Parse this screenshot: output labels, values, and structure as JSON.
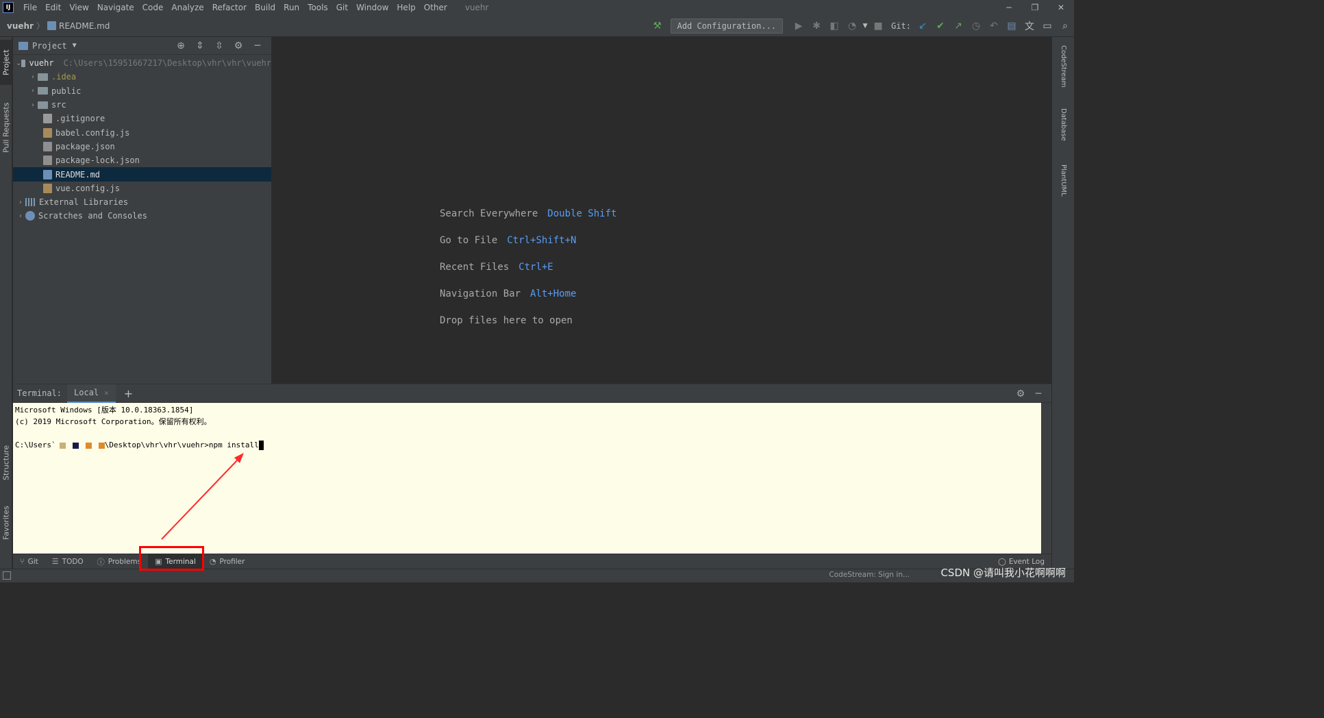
{
  "menubar": {
    "items": [
      "File",
      "Edit",
      "View",
      "Navigate",
      "Code",
      "Analyze",
      "Refactor",
      "Build",
      "Run",
      "Tools",
      "Git",
      "Window",
      "Help",
      "Other"
    ],
    "window_title": "vuehr"
  },
  "navbar": {
    "project": "vuehr",
    "file": "README.md",
    "add_config_label": "Add Configuration...",
    "git_label": "Git:"
  },
  "left_stripe": {
    "project_tab": "Project",
    "pull_requests_tab": "Pull Requests",
    "structure_tab": "Structure",
    "favorites_tab": "Favorites"
  },
  "right_stripe": {
    "codestream_tab": "CodeStream",
    "database_tab": "Database",
    "plantuml_tab": "PlantUML"
  },
  "project_panel": {
    "title": "Project",
    "root": {
      "name": "vuehr",
      "path": "C:\\Users\\15951667217\\Desktop\\vhr\\vhr\\vuehr"
    },
    "folders": [
      ".idea",
      "public",
      "src"
    ],
    "files": [
      ".gitignore",
      "babel.config.js",
      "package.json",
      "package-lock.json",
      "README.md",
      "vue.config.js"
    ],
    "external_libraries": "External Libraries",
    "scratches": "Scratches and Consoles"
  },
  "editor": {
    "hints": [
      {
        "label": "Search Everywhere",
        "key": "Double Shift"
      },
      {
        "label": "Go to File",
        "key": "Ctrl+Shift+N"
      },
      {
        "label": "Recent Files",
        "key": "Ctrl+E"
      },
      {
        "label": "Navigation Bar",
        "key": "Alt+Home"
      },
      {
        "label": "Drop files here to open",
        "key": ""
      }
    ]
  },
  "terminal": {
    "label": "Terminal:",
    "tab": "Local",
    "line1": "Microsoft Windows [版本 10.0.18363.1854]",
    "line2": "(c) 2019 Microsoft Corporation。保留所有权利。",
    "prompt_prefix": "C:\\Users`",
    "prompt_suffix": "\\Desktop\\vhr\\vhr\\vuehr>npm install"
  },
  "bottom_tabs": {
    "git": "Git",
    "todo": "TODO",
    "problems": "Problems",
    "terminal": "Terminal",
    "profiler": "Profiler",
    "event_log": "Event Log"
  },
  "statusbar": {
    "right_text": "CodeStream: Sign in...",
    "watermark": "CSDN @请叫我小花啊啊啊"
  },
  "colors": {
    "shortcut_blue": "#589df6",
    "highlight_red": "#ff0000",
    "terminal_bg": "#fefde8",
    "selection_bg": "#0d293e"
  }
}
